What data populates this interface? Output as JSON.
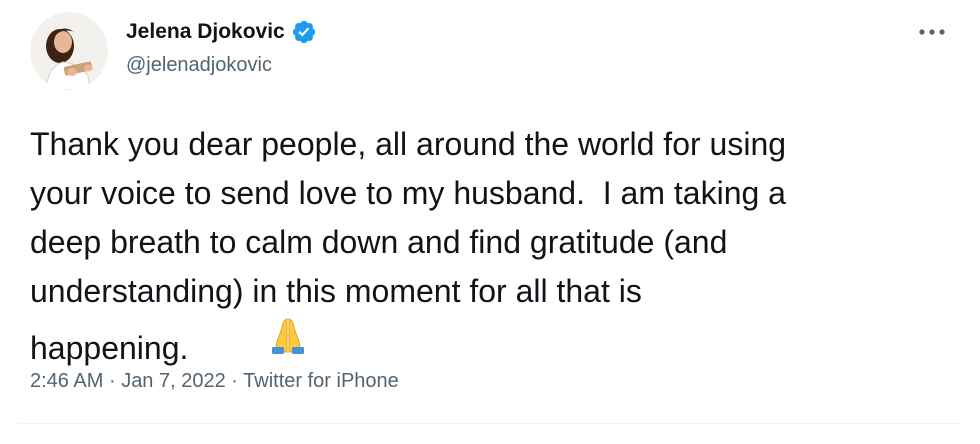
{
  "author": {
    "display_name": "Jelena Djokovic",
    "handle": "@jelenadjokovic",
    "verified": true,
    "avatar_icon": "profile-photo"
  },
  "more_icon": "more-dots-icon",
  "tweet": {
    "lines": [
      "Thank you dear people, all around the world for using",
      "your voice to send love to my husband.  I am taking a",
      "deep breath to calm down and find gratitude (and",
      "understanding) in this moment for all that is",
      "happening."
    ],
    "emoji": "folded-hands"
  },
  "meta": {
    "time": "2:46 AM",
    "separator": "·",
    "date": "Jan 7, 2022",
    "source": "Twitter for iPhone"
  },
  "colors": {
    "text": "#0f1419",
    "secondary": "#536471",
    "verified": "#1d9bf0",
    "divider": "#eff3f4"
  }
}
